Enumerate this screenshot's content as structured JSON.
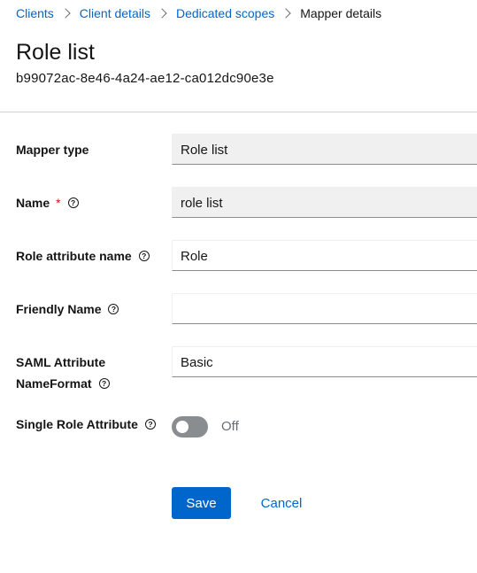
{
  "breadcrumb": {
    "items": [
      "Clients",
      "Client details",
      "Dedicated scopes"
    ],
    "current": "Mapper details"
  },
  "page": {
    "title": "Role list",
    "subtitle": "b99072ac-8e46-4a24-ae12-ca012dc90e3e"
  },
  "form": {
    "mapper_type": {
      "label": "Mapper type",
      "value": "Role list"
    },
    "name": {
      "label": "Name",
      "required_mark": "*",
      "value": "role list"
    },
    "role_attribute_name": {
      "label": "Role attribute name",
      "value": "Role"
    },
    "friendly_name": {
      "label": "Friendly Name",
      "value": ""
    },
    "saml_attribute_nameformat": {
      "label_line1": "SAML Attribute",
      "label_line2": "NameFormat",
      "value": "Basic"
    },
    "single_role_attribute": {
      "label": "Single Role Attribute",
      "state": "Off"
    }
  },
  "help_glyph": "?",
  "actions": {
    "save_label": "Save",
    "cancel_label": "Cancel"
  },
  "colors": {
    "primary": "#0066cc",
    "required": "#c9190b",
    "toggle_off": "#8a8d90"
  },
  "icons": {
    "breadcrumb_separator": "chevron-right-icon",
    "help": "help-circle-icon"
  }
}
